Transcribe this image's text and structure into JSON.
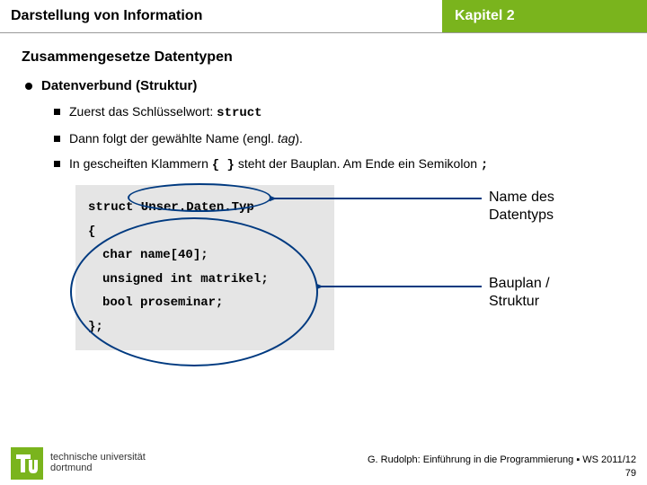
{
  "header": {
    "left": "Darstellung von Information",
    "right": "Kapitel 2"
  },
  "section_title": "Zusammengesetze Datentypen",
  "level1_text": "Datenverbund (Struktur)",
  "bullets": {
    "b1_pre": "Zuerst das Schlüsselwort: ",
    "b1_code": "struct",
    "b2_pre": "Dann folgt der gewählte Name (engl. ",
    "b2_tag": "tag",
    "b2_post": ").",
    "b3_pre": "In gescheiften Klammern ",
    "b3_code": "{ }",
    "b3_mid": " steht der Bauplan. Am Ende ein Semikolon ",
    "b3_semi": ";"
  },
  "code": {
    "l1": "struct Unser.Daten.Typ",
    "l2": "{",
    "l3": "char name[40];",
    "l4": "unsigned int matrikel;",
    "l5": "bool proseminar;",
    "l6": "};"
  },
  "annot": {
    "a1l1": "Name des",
    "a1l2": "Datentyps",
    "a2l1": "Bauplan /",
    "a2l2": "Struktur"
  },
  "footer": {
    "uni1": "technische universität",
    "uni2": "dortmund",
    "right": "G. Rudolph: Einführung in die Programmierung ▪ WS 2011/12",
    "page": "79"
  }
}
